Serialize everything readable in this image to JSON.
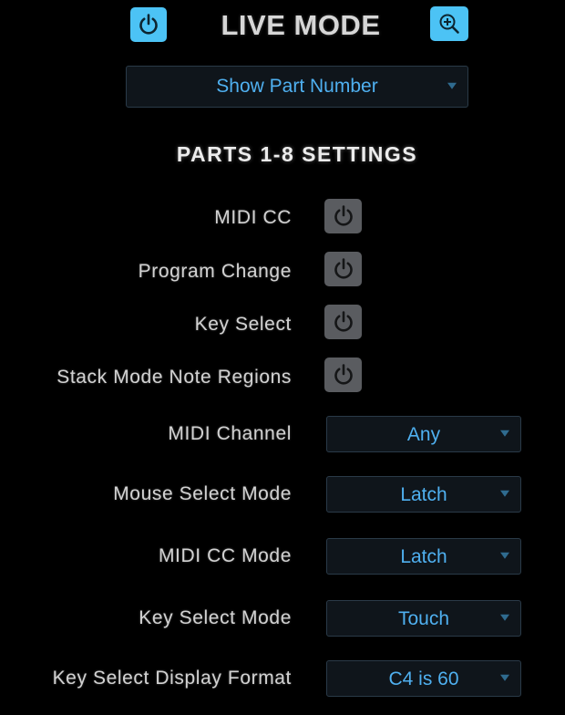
{
  "header": {
    "title": "LIVE MODE",
    "power_button": {
      "icon": "power-icon",
      "state": "on"
    },
    "zoom_button": {
      "icon": "zoom-in-icon"
    }
  },
  "display_dropdown": {
    "value": "Show Part Number"
  },
  "section_title": "PARTS 1-8 SETTINGS",
  "toggles": [
    {
      "label": "MIDI CC",
      "state": "off"
    },
    {
      "label": "Program Change",
      "state": "off"
    },
    {
      "label": "Key Select",
      "state": "off"
    },
    {
      "label": "Stack Mode Note Regions",
      "state": "off"
    }
  ],
  "selects": [
    {
      "label": "MIDI Channel",
      "value": "Any"
    },
    {
      "label": "Mouse Select Mode",
      "value": "Latch"
    },
    {
      "label": "MIDI CC Mode",
      "value": "Latch"
    },
    {
      "label": "Key Select Mode",
      "value": "Touch"
    },
    {
      "label": "Key Select Display Format",
      "value": "C4 is 60"
    }
  ],
  "colors": {
    "accent": "#4cc3f5",
    "value_text": "#4fb0f0",
    "toggle_off": "#5a5c60"
  }
}
